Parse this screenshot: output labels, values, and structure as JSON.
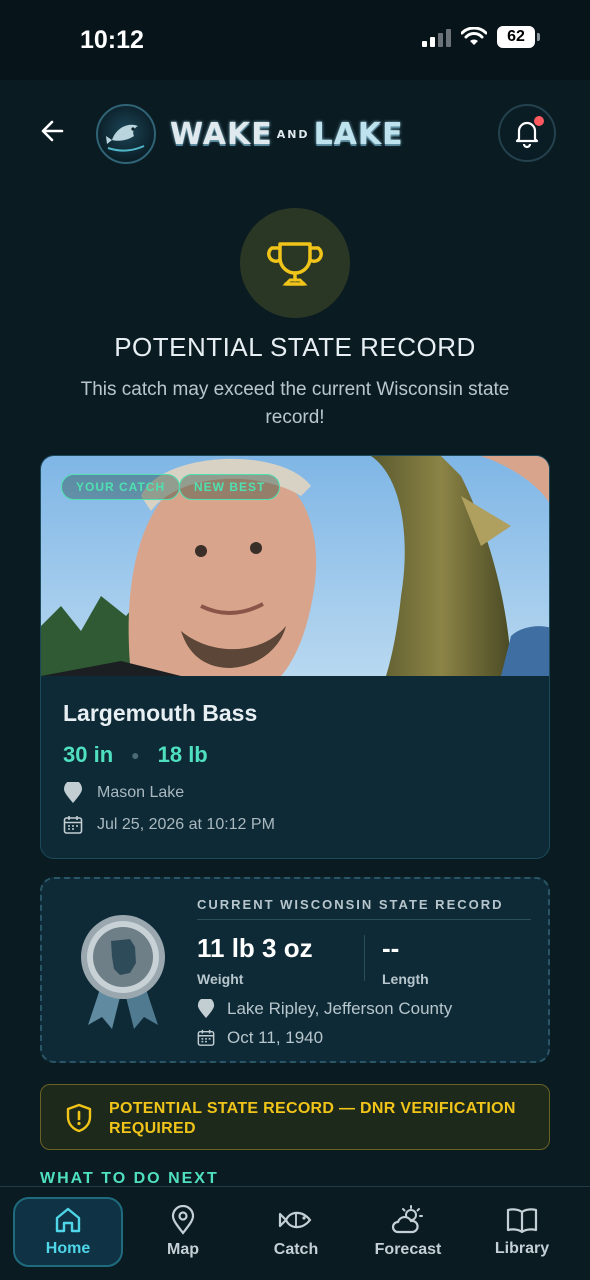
{
  "status_bar": {
    "time": "10:12",
    "battery": "62"
  },
  "header": {
    "back_icon": "arrow-left-icon",
    "logo_word_1": "WAKE",
    "logo_word_small": "AND",
    "logo_word_2": "LAKE",
    "bell_icon": "bell-icon"
  },
  "hero": {
    "icon": "trophy-icon",
    "title": "POTENTIAL STATE RECORD",
    "subtitle": "This catch may exceed the current Wisconsin state record!"
  },
  "catch": {
    "badges": [
      "YOUR CATCH",
      "NEW BEST"
    ],
    "species": "Largemouth Bass",
    "length": "30 in",
    "weight": "18 lb",
    "location": "Mason Lake",
    "date": "Jul 25, 2026 at 10:12 PM"
  },
  "state_record": {
    "title": "CURRENT WISCONSIN STATE RECORD",
    "weight_value": "11 lb 3 oz",
    "weight_label": "Weight",
    "length_value": "--",
    "length_label": "Length",
    "location": "Lake Ripley, Jefferson County",
    "date": "Oct 11, 1940"
  },
  "warning": {
    "text": "POTENTIAL STATE RECORD — DNR VERIFICATION REQUIRED"
  },
  "next": {
    "heading": "WHAT TO DO NEXT"
  },
  "tabs": [
    {
      "label": "Home",
      "icon": "home-icon",
      "active": true
    },
    {
      "label": "Map",
      "icon": "map-pin-icon",
      "active": false
    },
    {
      "label": "Catch",
      "icon": "fish-icon",
      "active": false
    },
    {
      "label": "Forecast",
      "icon": "weather-icon",
      "active": false
    },
    {
      "label": "Library",
      "icon": "book-icon",
      "active": false
    }
  ],
  "colors": {
    "background": "#0a1b22",
    "accent": "#4fe0c0",
    "warning": "#f0c419",
    "card": "#0e2a36"
  }
}
